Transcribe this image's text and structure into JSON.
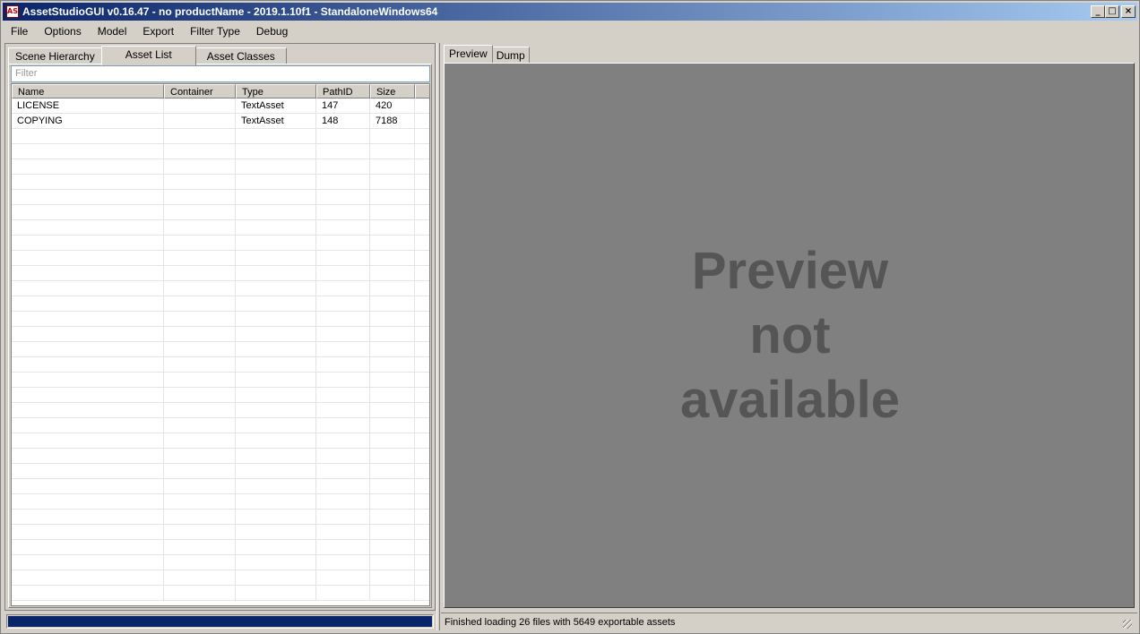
{
  "app": {
    "title": "AssetStudioGUI v0.16.47 - no productName - 2019.1.10f1 - StandaloneWindows64",
    "icon_text": "AS"
  },
  "window_buttons": {
    "minimize": "_",
    "maximize": "□",
    "close": "×"
  },
  "menu": [
    "File",
    "Options",
    "Model",
    "Export",
    "Filter Type",
    "Debug"
  ],
  "left_tabs": [
    "Scene Hierarchy",
    "Asset List",
    "Asset Classes"
  ],
  "active_left_tab": "Asset List",
  "filter": {
    "placeholder": "Filter",
    "value": ""
  },
  "asset_list": {
    "columns": [
      "Name",
      "Container",
      "Type",
      "PathID",
      "Size"
    ],
    "rows": [
      {
        "name": "LICENSE",
        "container": "",
        "type": "TextAsset",
        "path_id": "147",
        "size": "420"
      },
      {
        "name": "COPYING",
        "container": "",
        "type": "TextAsset",
        "path_id": "148",
        "size": "7188"
      }
    ]
  },
  "right_tabs": [
    "Preview",
    "Dump"
  ],
  "active_right_tab": "Preview",
  "preview": {
    "lines": [
      "Preview",
      "not",
      "available"
    ]
  },
  "progress": {
    "value_percent": 100
  },
  "status_text": "Finished loading 26 files with 5649 exportable assets",
  "colors": {
    "titlebar": "#0a246a",
    "chrome": "#d4d0c8",
    "preview_bg": "#808080",
    "progress": "#0a246a"
  }
}
